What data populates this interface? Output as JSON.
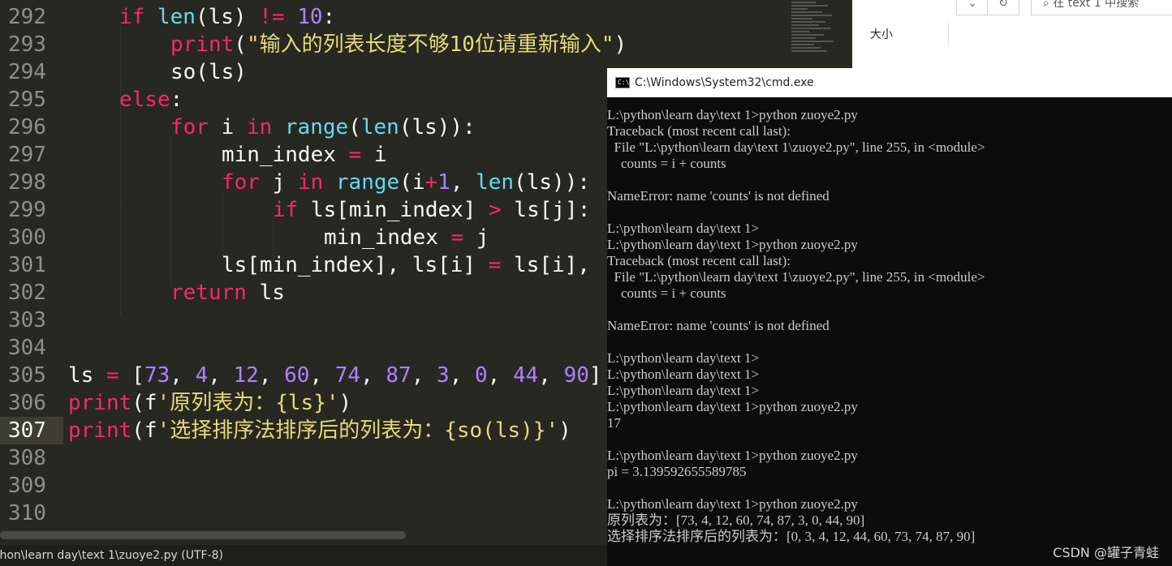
{
  "editor": {
    "lines": [
      {
        "num": "292"
      },
      {
        "num": "293"
      },
      {
        "num": "294"
      },
      {
        "num": "295"
      },
      {
        "num": "296"
      },
      {
        "num": "297"
      },
      {
        "num": "298"
      },
      {
        "num": "299"
      },
      {
        "num": "300"
      },
      {
        "num": "301"
      },
      {
        "num": "302"
      },
      {
        "num": "303"
      },
      {
        "num": "304"
      },
      {
        "num": "305"
      },
      {
        "num": "306"
      },
      {
        "num": "307"
      },
      {
        "num": "308"
      },
      {
        "num": "309"
      },
      {
        "num": "310"
      }
    ],
    "code": {
      "l292": {
        "a": "if ",
        "b": "len",
        "c": "(ls) ",
        "d": "!=",
        "e": " ",
        "f": "10",
        "g": ":"
      },
      "l293": {
        "a": "print",
        "b": "(",
        "c": "\"输入的列表长度不够10位请重新输入\"",
        "d": ")"
      },
      "l294": {
        "a": "so(ls)"
      },
      "l295": {
        "a": "else",
        ":": ":"
      },
      "l296": {
        "a": "for",
        "b": " i ",
        "c": "in",
        "d": " ",
        "e": "range",
        "f": "(",
        "g": "len",
        "h": "(ls)):"
      },
      "l297": {
        "a": "min_index ",
        "b": "=",
        "c": " i"
      },
      "l298": {
        "a": "for",
        "b": " j ",
        "c": "in",
        "d": " ",
        "e": "range",
        "f": "(i",
        "g": "+",
        "h": "1",
        "i": ", ",
        "j": "len",
        "k": "(ls)):"
      },
      "l299": {
        "a": "if",
        "b": " ls[min_index] ",
        "c": ">",
        "d": " ls[j]:"
      },
      "l300": {
        "a": "min_index ",
        "b": "=",
        "c": " j"
      },
      "l301": {
        "a": "ls[min_index], ls[i] ",
        "b": "=",
        "c": " ls[i],"
      },
      "l302": {
        "a": "return",
        "b": " ls"
      },
      "l305": {
        "a": "ls ",
        "b": "=",
        "c": " [",
        "d": "73",
        ",1": ", ",
        "e": "4",
        ",2": ", ",
        "f": "12",
        ",3": ", ",
        "g": "60",
        ",4": ", ",
        "h": "74",
        ",5": ", ",
        "i": "87",
        ",6": ", ",
        "j": "3",
        ",7": ", ",
        "k": "0",
        ",8": ", ",
        "l": "44",
        ",9": ", ",
        "m": "90",
        "n": "]"
      },
      "l306": {
        "a": "print",
        "b": "(f",
        "c": "'原列表为：",
        "d": "{ls}",
        "e": "'",
        ")": ")"
      },
      "l307": {
        "a": "print",
        "b": "(f",
        "c": "'选择排序法排序后的列表为：",
        "d": "{so(ls)}",
        "e": "'",
        ")": ")"
      }
    },
    "status": "thon\\learn day\\text 1\\zuoye2.py (UTF-8)"
  },
  "explorer": {
    "btn_dropdown": "⌄",
    "btn_refresh": "↻",
    "search_placeholder": "⌕  在 text 1 中搜索",
    "column_size": "大小"
  },
  "cmd": {
    "title": "C:\\Windows\\System32\\cmd.exe",
    "icon_text": "C:\\",
    "lines": [
      "L:\\python\\learn day\\text 1>python zuoye2.py",
      "Traceback (most recent call last):",
      "  File \"L:\\python\\learn day\\text 1\\zuoye2.py\", line 255, in <module>",
      "    counts = i + counts",
      "",
      "NameError: name 'counts' is not defined",
      "",
      "L:\\python\\learn day\\text 1>",
      "L:\\python\\learn day\\text 1>python zuoye2.py",
      "Traceback (most recent call last):",
      "  File \"L:\\python\\learn day\\text 1\\zuoye2.py\", line 255, in <module>",
      "    counts = i + counts",
      "",
      "NameError: name 'counts' is not defined",
      "",
      "L:\\python\\learn day\\text 1>",
      "L:\\python\\learn day\\text 1>",
      "L:\\python\\learn day\\text 1>",
      "L:\\python\\learn day\\text 1>python zuoye2.py",
      "17",
      "",
      "L:\\python\\learn day\\text 1>python zuoye2.py",
      "pi = 3.139592655589785",
      "",
      "L:\\python\\learn day\\text 1>python zuoye2.py",
      "原列表为：[73, 4, 12, 60, 74, 87, 3, 0, 44, 90]",
      "选择排序法排序后的列表为：[0, 3, 4, 12, 44, 60, 73, 74, 87, 90]"
    ]
  },
  "watermark": "CSDN @罐子青蛙"
}
